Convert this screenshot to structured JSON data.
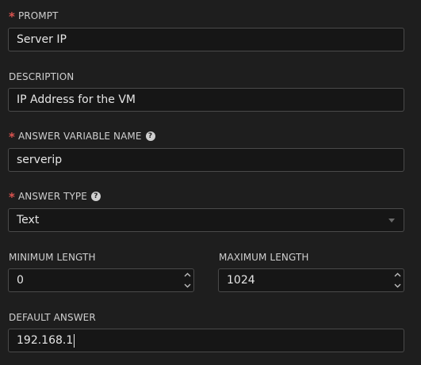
{
  "prompt": {
    "required_mark": "*",
    "label": "PROMPT",
    "value": "Server IP"
  },
  "description": {
    "label": "DESCRIPTION",
    "value": "IP Address for the VM"
  },
  "answer_variable_name": {
    "required_mark": "*",
    "label": "ANSWER VARIABLE NAME",
    "help_glyph": "?",
    "value": "serverip"
  },
  "answer_type": {
    "required_mark": "*",
    "label": "ANSWER TYPE",
    "help_glyph": "?",
    "selected": "Text"
  },
  "minimum_length": {
    "label": "MINIMUM LENGTH",
    "value": "0"
  },
  "maximum_length": {
    "label": "MAXIMUM LENGTH",
    "value": "1024"
  },
  "default_answer": {
    "label": "DEFAULT ANSWER",
    "value": "192.168.1"
  },
  "colors": {
    "background": "#1e1e1e",
    "field_background": "#161616",
    "field_border": "#4a4a4a",
    "required_mark": "#d9534f",
    "text": "#e6e6e6"
  },
  "icons": {
    "help": "question-circle-icon",
    "select_caret": "caret-down-icon",
    "spin_up": "chevron-up-icon",
    "spin_down": "chevron-down-icon"
  }
}
